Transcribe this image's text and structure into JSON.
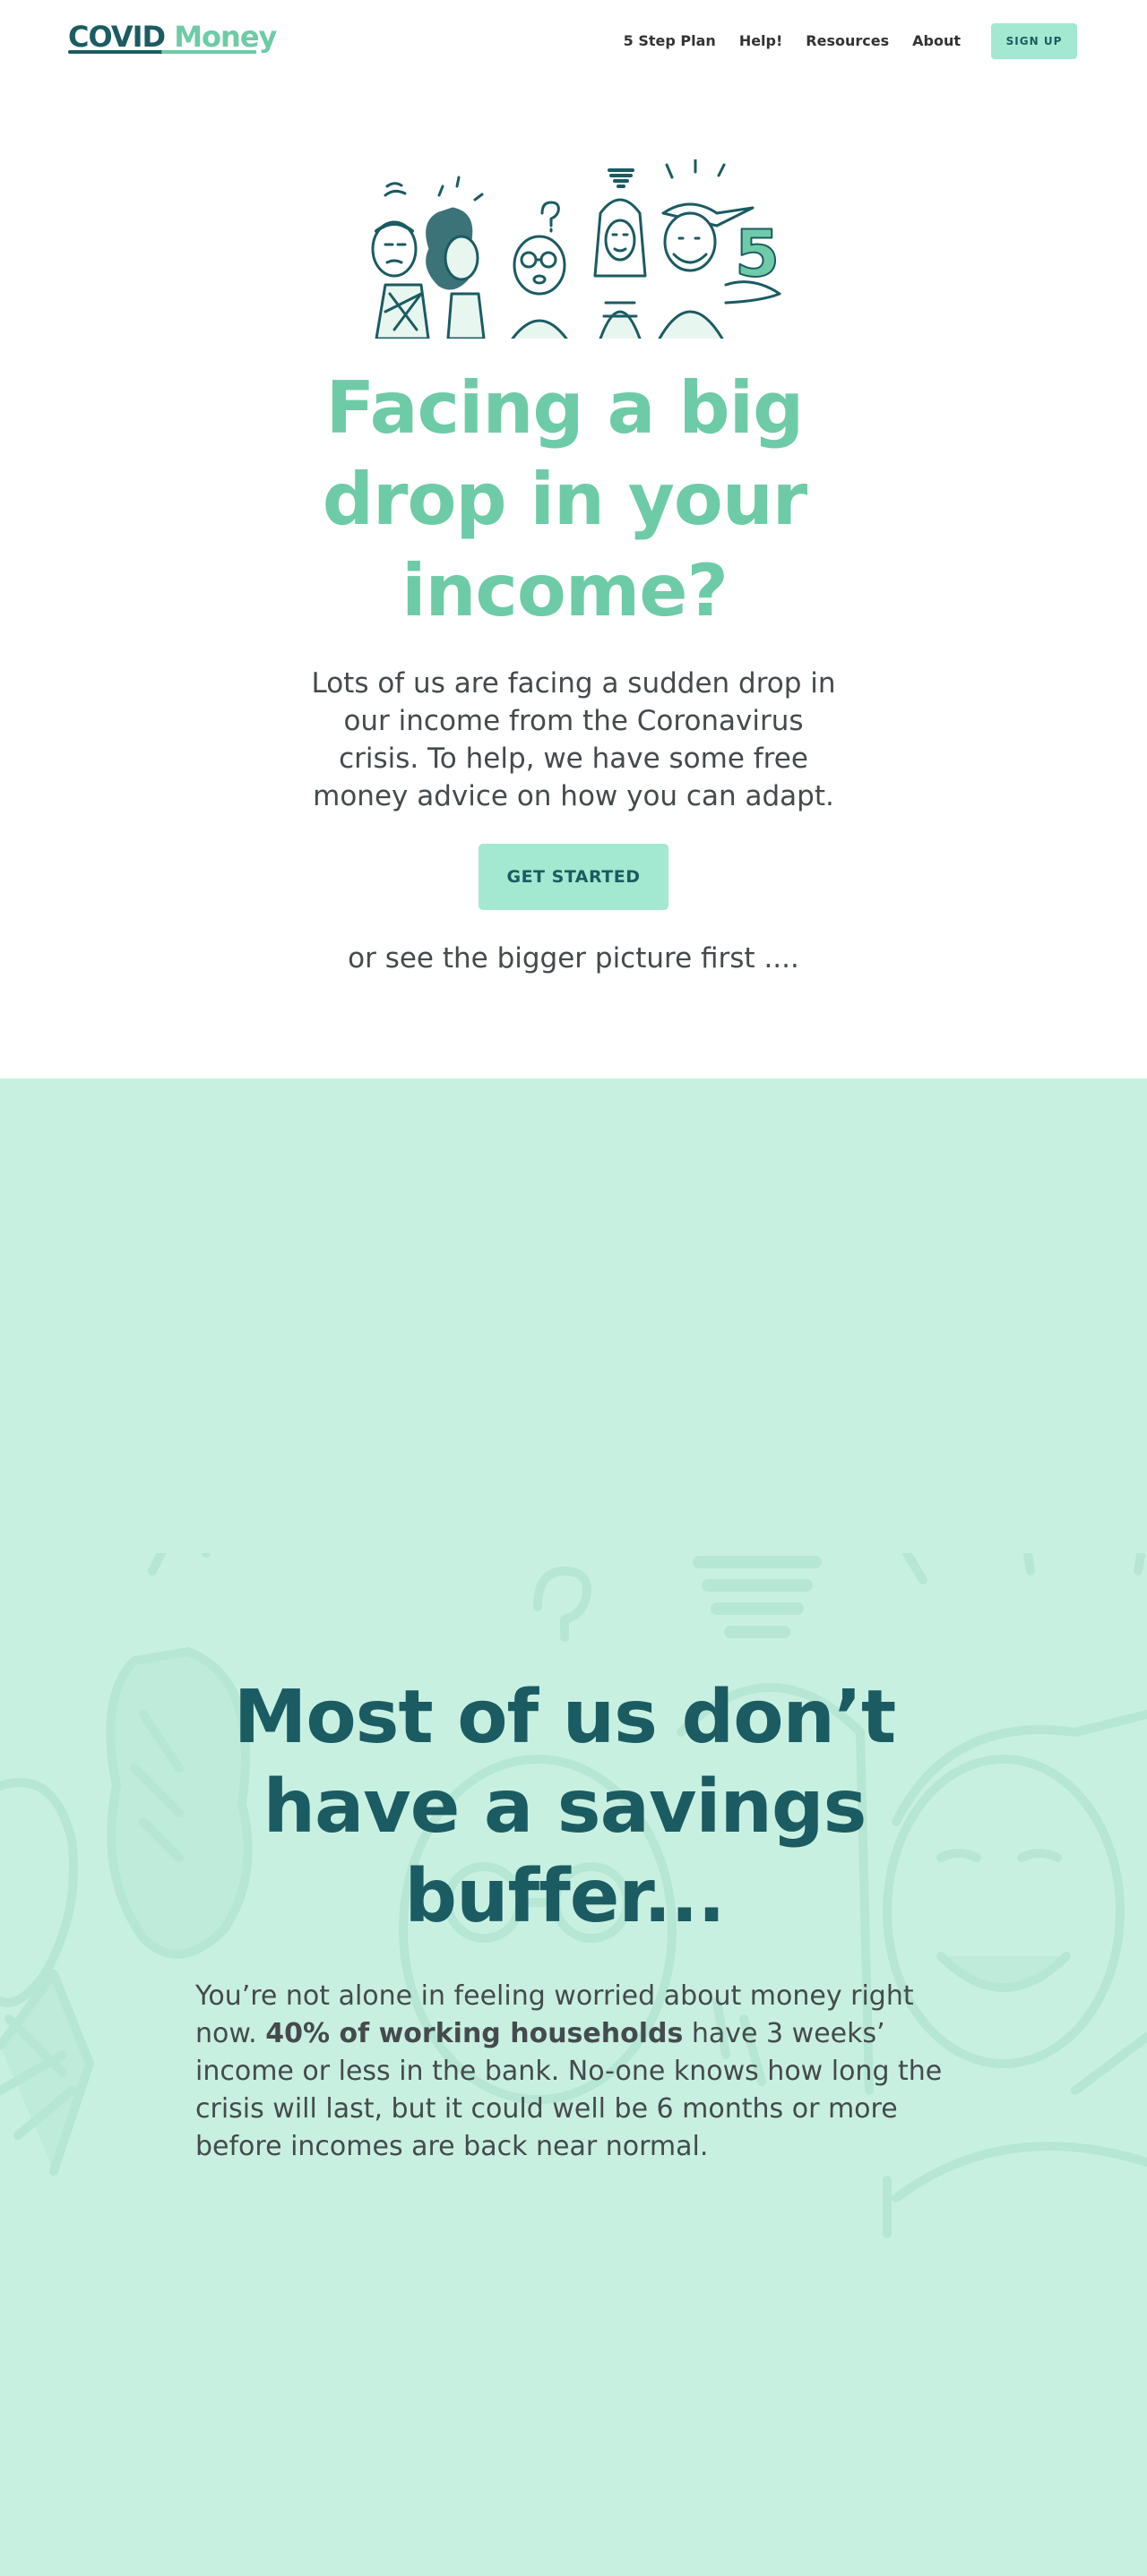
{
  "nav": {
    "logo_part1": "COVID",
    "logo_part2": "Money",
    "links": [
      "5 Step Plan",
      "Help!",
      "Resources",
      "About"
    ],
    "signup_label": "SIGN UP"
  },
  "hero": {
    "title": "Facing a big drop in your income?",
    "text": "Lots of us are facing a sudden drop in our income from the Coronavirus crisis. To help, we have some free money advice on how you can adapt.",
    "cta_label": "GET STARTED",
    "see_more": "or see the bigger picture first ...."
  },
  "section2": {
    "title": "Most of us don’t have a savings buffer...",
    "text_before": "You’re not alone in feeling worried about money right now.",
    "text_bold": "40% of working households",
    "text_after": "have 3 weeks’ income or less in the bank. No-one knows how long the crisis will last, but it could well be 6 months or more before incomes are back near normal."
  },
  "illustration": {
    "number": "5"
  },
  "colors": {
    "brand_dark": "#1b5b62",
    "brand_light": "#6ecba7",
    "button_bg": "#a3e8d0",
    "section_bg": "#c8f0e1",
    "text": "#444a4d"
  },
  "icons": [
    "people-illustration",
    "people-background-illustration"
  ]
}
